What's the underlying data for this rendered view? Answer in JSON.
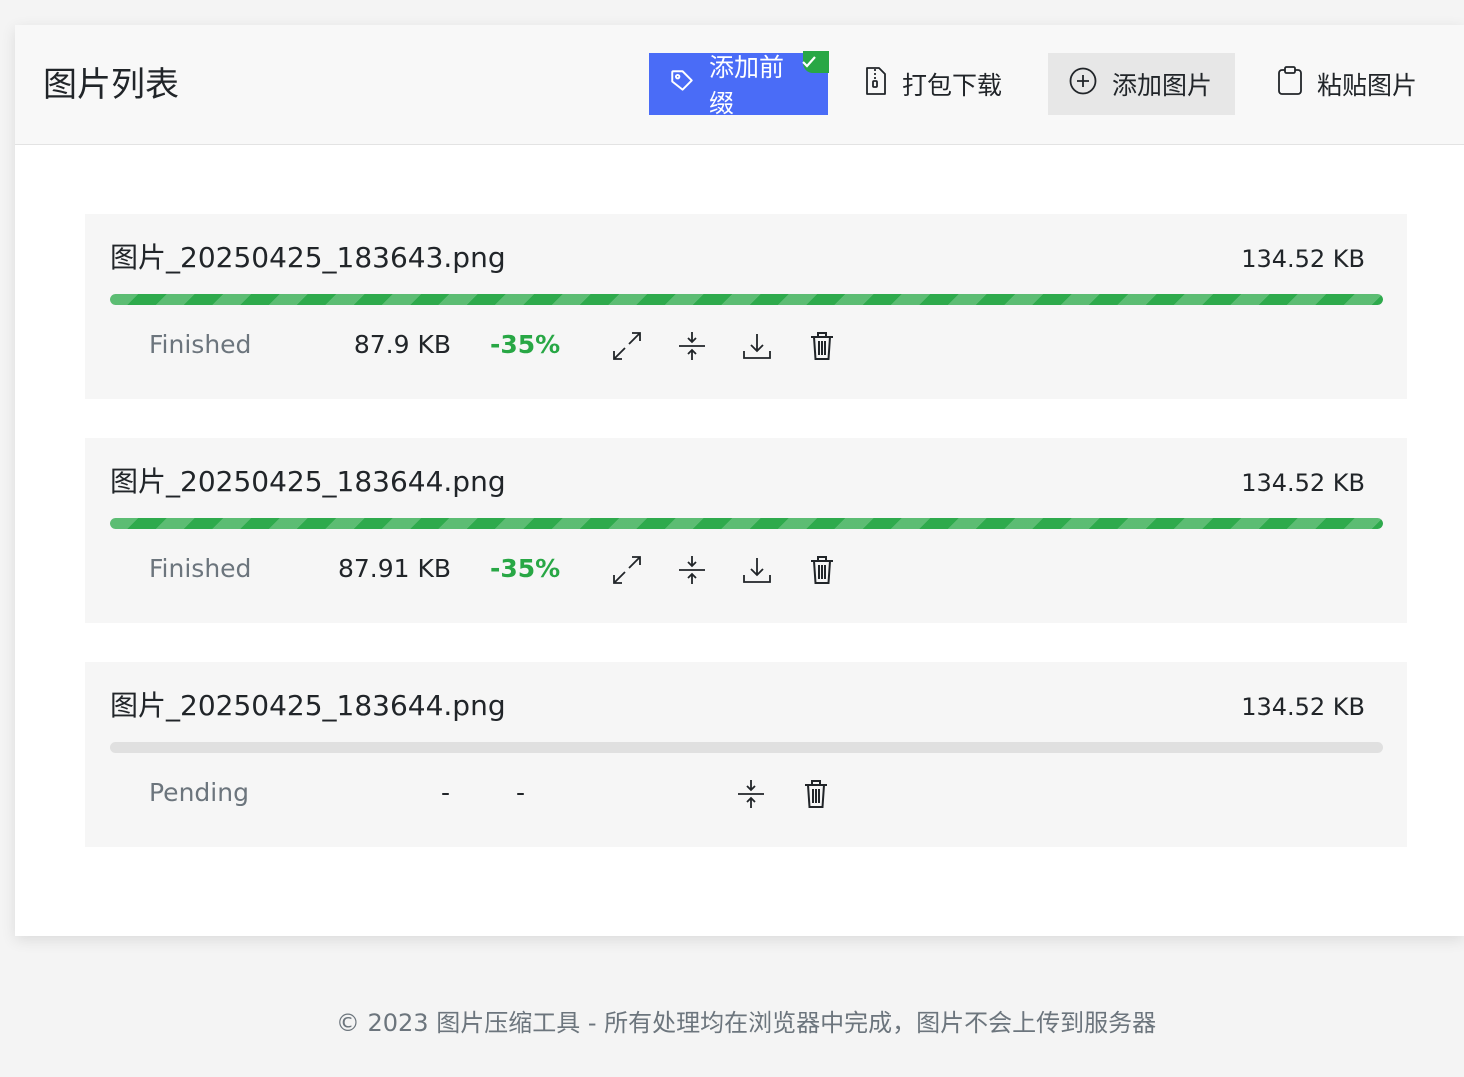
{
  "header": {
    "title": "图片列表",
    "buttons": {
      "add_prefix": "添加前缀",
      "pack_download": "打包下载",
      "add_image": "添加图片",
      "paste_image": "粘贴图片"
    }
  },
  "colors": {
    "primary": "#4a6cf7",
    "success": "#28a745",
    "progress": "#2eaa4c",
    "muted": "#6c757d"
  },
  "items": [
    {
      "filename": "图片_20250425_183643.png",
      "original_size": "134.52 KB",
      "progress_percent": 100,
      "status": "Finished",
      "compressed_size": "87.9 KB",
      "reduction": "-35%"
    },
    {
      "filename": "图片_20250425_183644.png",
      "original_size": "134.52 KB",
      "progress_percent": 100,
      "status": "Finished",
      "compressed_size": "87.91 KB",
      "reduction": "-35%"
    },
    {
      "filename": "图片_20250425_183644.png",
      "original_size": "134.52 KB",
      "progress_percent": 0,
      "status": "Pending",
      "compressed_size": "-",
      "reduction": "-"
    }
  ],
  "footer": {
    "text": "© 2023 图片压缩工具 - 所有处理均在浏览器中完成，图片不会上传到服务器"
  }
}
